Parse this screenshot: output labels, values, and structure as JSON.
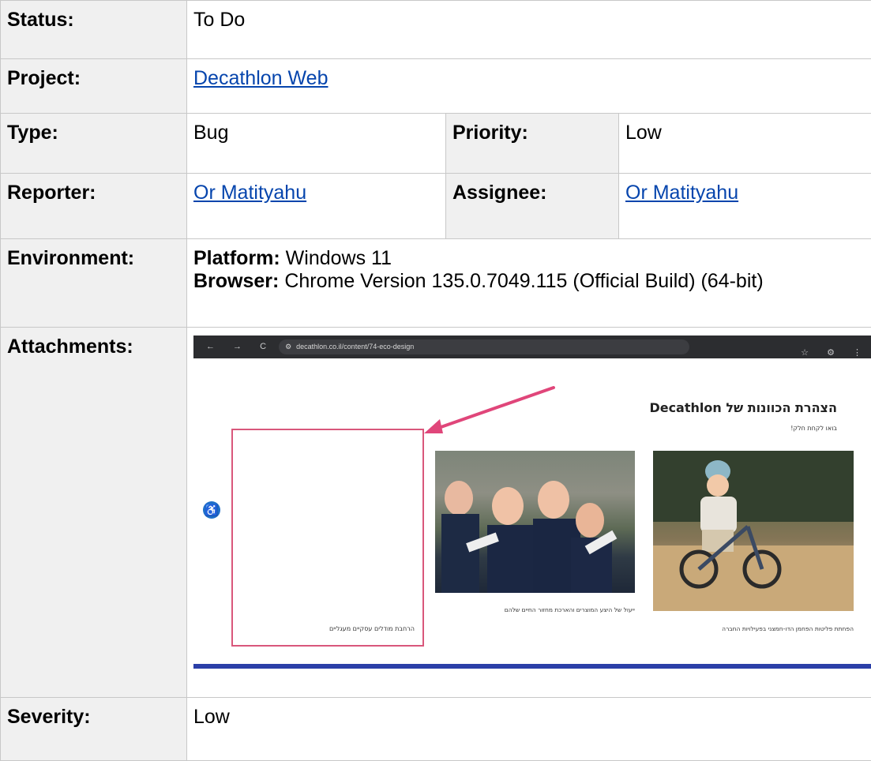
{
  "status": {
    "label": "Status:",
    "value": "To Do"
  },
  "project": {
    "label": "Project:",
    "value": "Decathlon Web"
  },
  "type": {
    "label": "Type:",
    "value": "Bug"
  },
  "priority": {
    "label": "Priority:",
    "value": "Low"
  },
  "reporter": {
    "label": "Reporter:",
    "value": "Or Matityahu"
  },
  "assignee": {
    "label": "Assignee:",
    "value": "Or Matityahu"
  },
  "environment": {
    "label": "Environment:",
    "platform_label": "Platform:",
    "platform_value": " Windows 11",
    "browser_label": "Browser:",
    "browser_value": " Chrome Version 135.0.7049.115 (Official Build) (64-bit)"
  },
  "attachments": {
    "label": "Attachments:",
    "screenshot": {
      "nav_icons": "← → C",
      "url": "decathlon.co.il/content/74-eco-design",
      "right_icons": "☆ ⚙ ⋮",
      "title": "הצהרת הכוונות של Decathlon",
      "subtitle": "בואו לקחת חלק!",
      "caption_box": "הרחבת מודלים עסקיים מעגליים",
      "caption_1": "ייעול של היצע המוצרים והארכת מחזור החיים שלהם",
      "caption_2": "הפחתת פליטות הפחמן הדו-חמצני בפעילויות החברה",
      "accessibility_icon": "accessibility-icon",
      "accent": "#d9577b"
    }
  },
  "severity": {
    "label": "Severity:",
    "value": "Low"
  },
  "colors": {
    "label_bg": "#f0f0f0",
    "link": "#0645ad",
    "border": "#c8c8c8"
  }
}
